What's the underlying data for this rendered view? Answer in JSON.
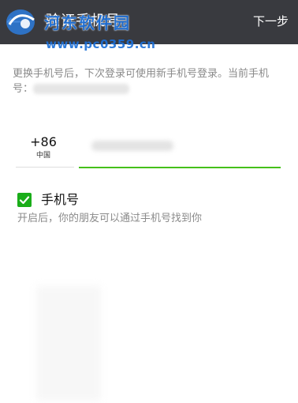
{
  "app_bar": {
    "title": "验证手机号",
    "next_label": "下一步",
    "back_icon": "back-arrow-icon",
    "background": "#393a3f"
  },
  "watermark": {
    "name": "河东软件园",
    "url": "www.pc0359.cn",
    "color": "#1b6fd8"
  },
  "hint": {
    "text": "更换手机号后，下次登录可使用新手机号登录。当前手机号："
  },
  "phone": {
    "country_code": "+86",
    "country_name": "中国",
    "underline_color": "#45c01a"
  },
  "discover": {
    "checked": true,
    "label": "手机号",
    "description": "开启后，你的朋友可以通过手机号找到你",
    "check_color": "#1aad19"
  }
}
